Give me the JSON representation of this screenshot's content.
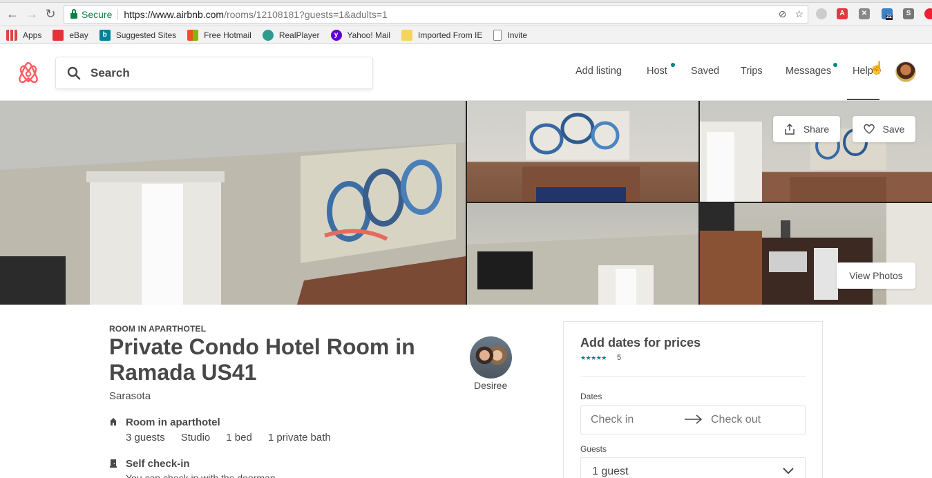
{
  "browser": {
    "secure_label": "Secure",
    "url_host": "https://www.airbnb.com",
    "url_path": "/rooms/12108181?guests=1&adults=1",
    "extension_badge": "22",
    "bookmarks": [
      {
        "label": "Apps",
        "icon": "apps-grid-icon"
      },
      {
        "label": "eBay",
        "icon": "ebay-icon"
      },
      {
        "label": "Suggested Sites",
        "icon": "bing-icon"
      },
      {
        "label": "Free Hotmail",
        "icon": "windows-icon"
      },
      {
        "label": "RealPlayer",
        "icon": "realplayer-icon"
      },
      {
        "label": "Yahoo! Mail",
        "icon": "yahoo-icon"
      },
      {
        "label": "Imported From IE",
        "icon": "folder-icon"
      },
      {
        "label": "Invite",
        "icon": "page-icon"
      }
    ]
  },
  "header": {
    "search_placeholder": "Search",
    "nav": {
      "add_listing": "Add listing",
      "host": "Host",
      "saved": "Saved",
      "trips": "Trips",
      "messages": "Messages",
      "help": "Help"
    }
  },
  "photos": {
    "share_label": "Share",
    "save_label": "Save",
    "view_photos_label": "View Photos"
  },
  "listing": {
    "kicker": "ROOM IN APARTHOTEL",
    "title": "Private Condo Hotel Room in Ramada US41",
    "city": "Sarasota",
    "host_name": "Desiree",
    "features": [
      {
        "title": "Room in aparthotel",
        "icon": "home-icon"
      },
      {
        "title": "Self check-in",
        "icon": "door-icon",
        "desc": "You can check in with the doorman."
      }
    ],
    "stats": [
      "3 guests",
      "Studio",
      "1 bed",
      "1 private bath"
    ]
  },
  "booking": {
    "title": "Add dates for prices",
    "stars": "★★★★★",
    "rating_count": "5",
    "dates_label": "Dates",
    "check_in": "Check in",
    "check_out": "Check out",
    "guests_label": "Guests",
    "guests_value": "1 guest"
  },
  "colors": {
    "brand": "#FF5A5F",
    "teal": "#008489",
    "text": "#484848"
  }
}
